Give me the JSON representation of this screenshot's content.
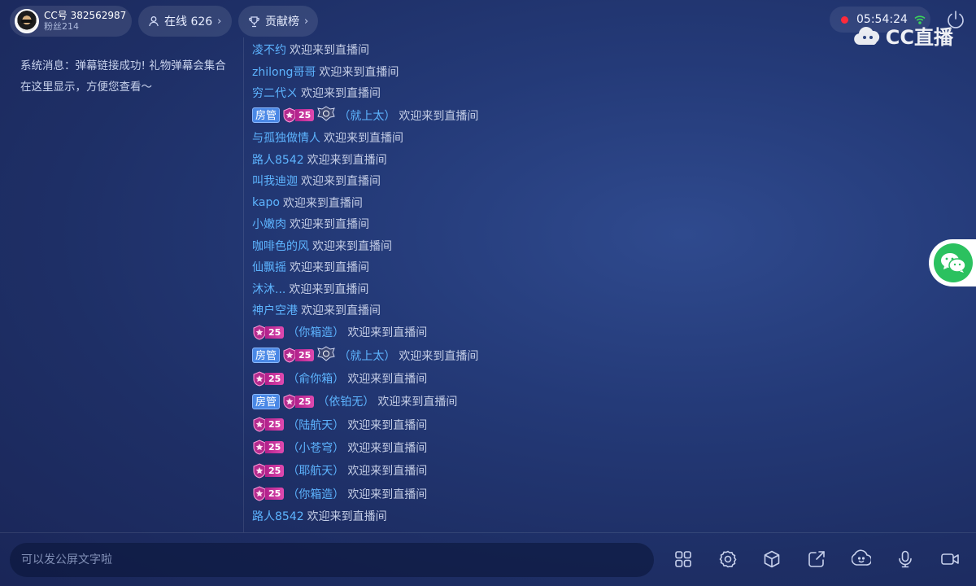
{
  "header": {
    "profile": {
      "cc_id": "CC号 382562987",
      "fans": "粉丝214"
    },
    "online": {
      "label": "在线 626",
      "chevron": "›"
    },
    "contribution": {
      "label": "贡献榜",
      "chevron": "›"
    },
    "timer": "05:54:24",
    "logo_text": "CC直播"
  },
  "system": {
    "message": "系统消息：弹幕链接成功! 礼物弹幕会集合在这里显示，方便您查看～"
  },
  "chat": {
    "welcome": "欢迎来到直播间",
    "admin_label": "房管",
    "level": "25",
    "messages": [
      {
        "name": "凌不约"
      },
      {
        "name": "zhilong哥哥"
      },
      {
        "name": "穷二代ㄨ"
      },
      {
        "name": "（就上太）",
        "admin": true,
        "level": true,
        "crest": true
      },
      {
        "name": "与孤独做情人"
      },
      {
        "name": "路人8542"
      },
      {
        "name": "叫我迪迦"
      },
      {
        "name": "kapo"
      },
      {
        "name": "小嫩肉"
      },
      {
        "name": "咖啡色的风"
      },
      {
        "name": "仙飘摇"
      },
      {
        "name": "沐沐..."
      },
      {
        "name": "神户空港"
      },
      {
        "name": "（你箱造）",
        "level": true
      },
      {
        "name": "（就上太）",
        "admin": true,
        "level": true,
        "crest": true
      },
      {
        "name": "（俞你箱）",
        "level": true
      },
      {
        "name": "（依铂无）",
        "admin": true,
        "level": true
      },
      {
        "name": "（陆航天）",
        "level": true
      },
      {
        "name": "（小苍穹）",
        "level": true
      },
      {
        "name": "（耶航天）",
        "level": true
      },
      {
        "name": "（你箱造）",
        "level": true
      },
      {
        "name": "路人8542"
      }
    ]
  },
  "input": {
    "placeholder": "可以发公屏文字啦"
  },
  "toolbar": {
    "icons": [
      "apps-grid-icon",
      "settings-icon",
      "cube-icon",
      "share-icon",
      "emoji-icon",
      "microphone-icon",
      "camera-icon"
    ]
  },
  "colors": {
    "username": "#5db4ff",
    "admin_badge": "#4a88e6",
    "level_badge": "#d13aa0",
    "record_dot": "#ff2a3a",
    "wechat": "#2bc15f"
  }
}
